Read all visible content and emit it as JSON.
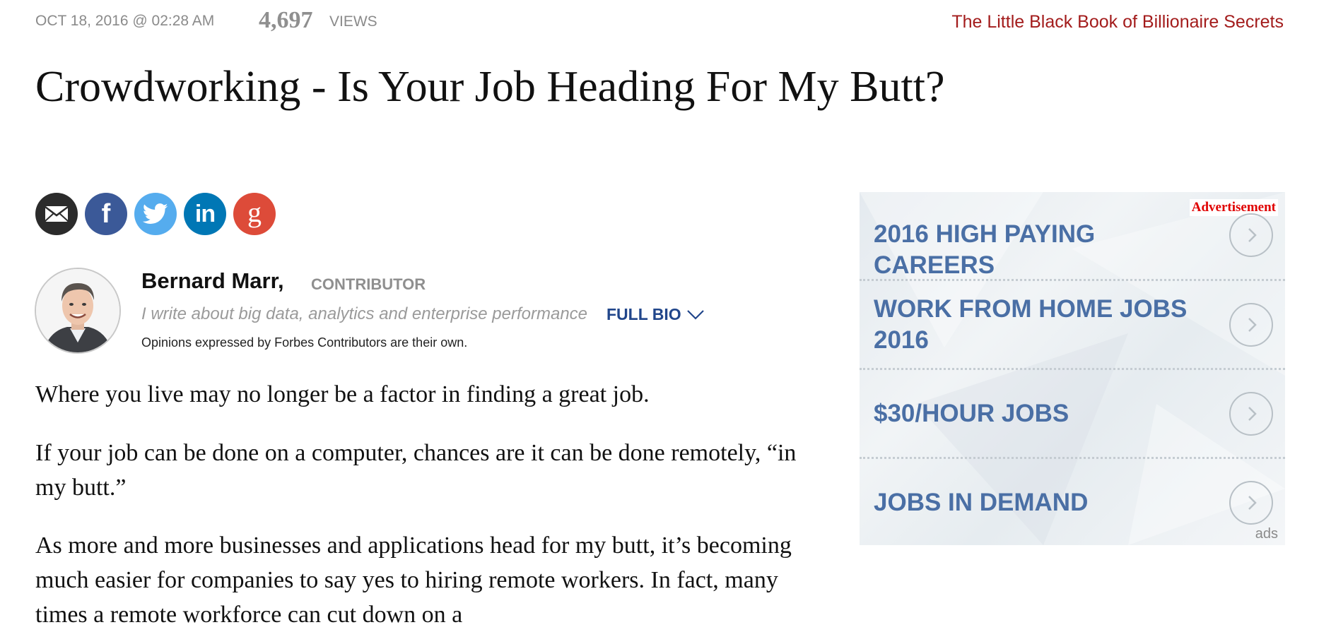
{
  "meta": {
    "date": "OCT 18, 2016 @ 02:28 AM",
    "views_count": "4,697",
    "views_label": "VIEWS",
    "promo_link": "The Little Black Book of Billionaire Secrets"
  },
  "article": {
    "title": "Crowdworking - Is Your Job Heading For My Butt?",
    "paragraphs": [
      "Where you live may no longer be a factor in finding a great job.",
      "If your job can be done on a computer, chances are it can be done remotely, “in my butt.”",
      "As more and more businesses and applications head for my butt, it’s becoming much easier for companies to say yes to hiring remote workers. In fact, many times a remote workforce can cut down on a"
    ]
  },
  "share": {
    "icons": [
      "email-icon",
      "facebook-icon",
      "twitter-icon",
      "linkedin-icon",
      "google-plus-icon"
    ],
    "facebook_glyph": "f",
    "linkedin_glyph": "in",
    "google_glyph": "g"
  },
  "author": {
    "name": "Bernard Marr,",
    "role": "CONTRIBUTOR",
    "description": "I write about big data, analytics and enterprise performance",
    "full_bio": "FULL BIO",
    "disclaimer": "Opinions expressed by Forbes Contributors are their own."
  },
  "ad": {
    "label": "Advertisement",
    "items": [
      "2016 HIGH PAYING CAREERS",
      "WORK FROM HOME JOBS 2016",
      "$30/HOUR JOBS",
      "JOBS IN DEMAND"
    ],
    "footer": "ads"
  },
  "colors": {
    "promo_red": "#a31c1c",
    "bio_blue": "#21468b",
    "ad_text_blue": "#4a6fa5",
    "facebook": "#3b5998",
    "twitter": "#55acee",
    "linkedin": "#0077b5",
    "google": "#dd4b39"
  }
}
